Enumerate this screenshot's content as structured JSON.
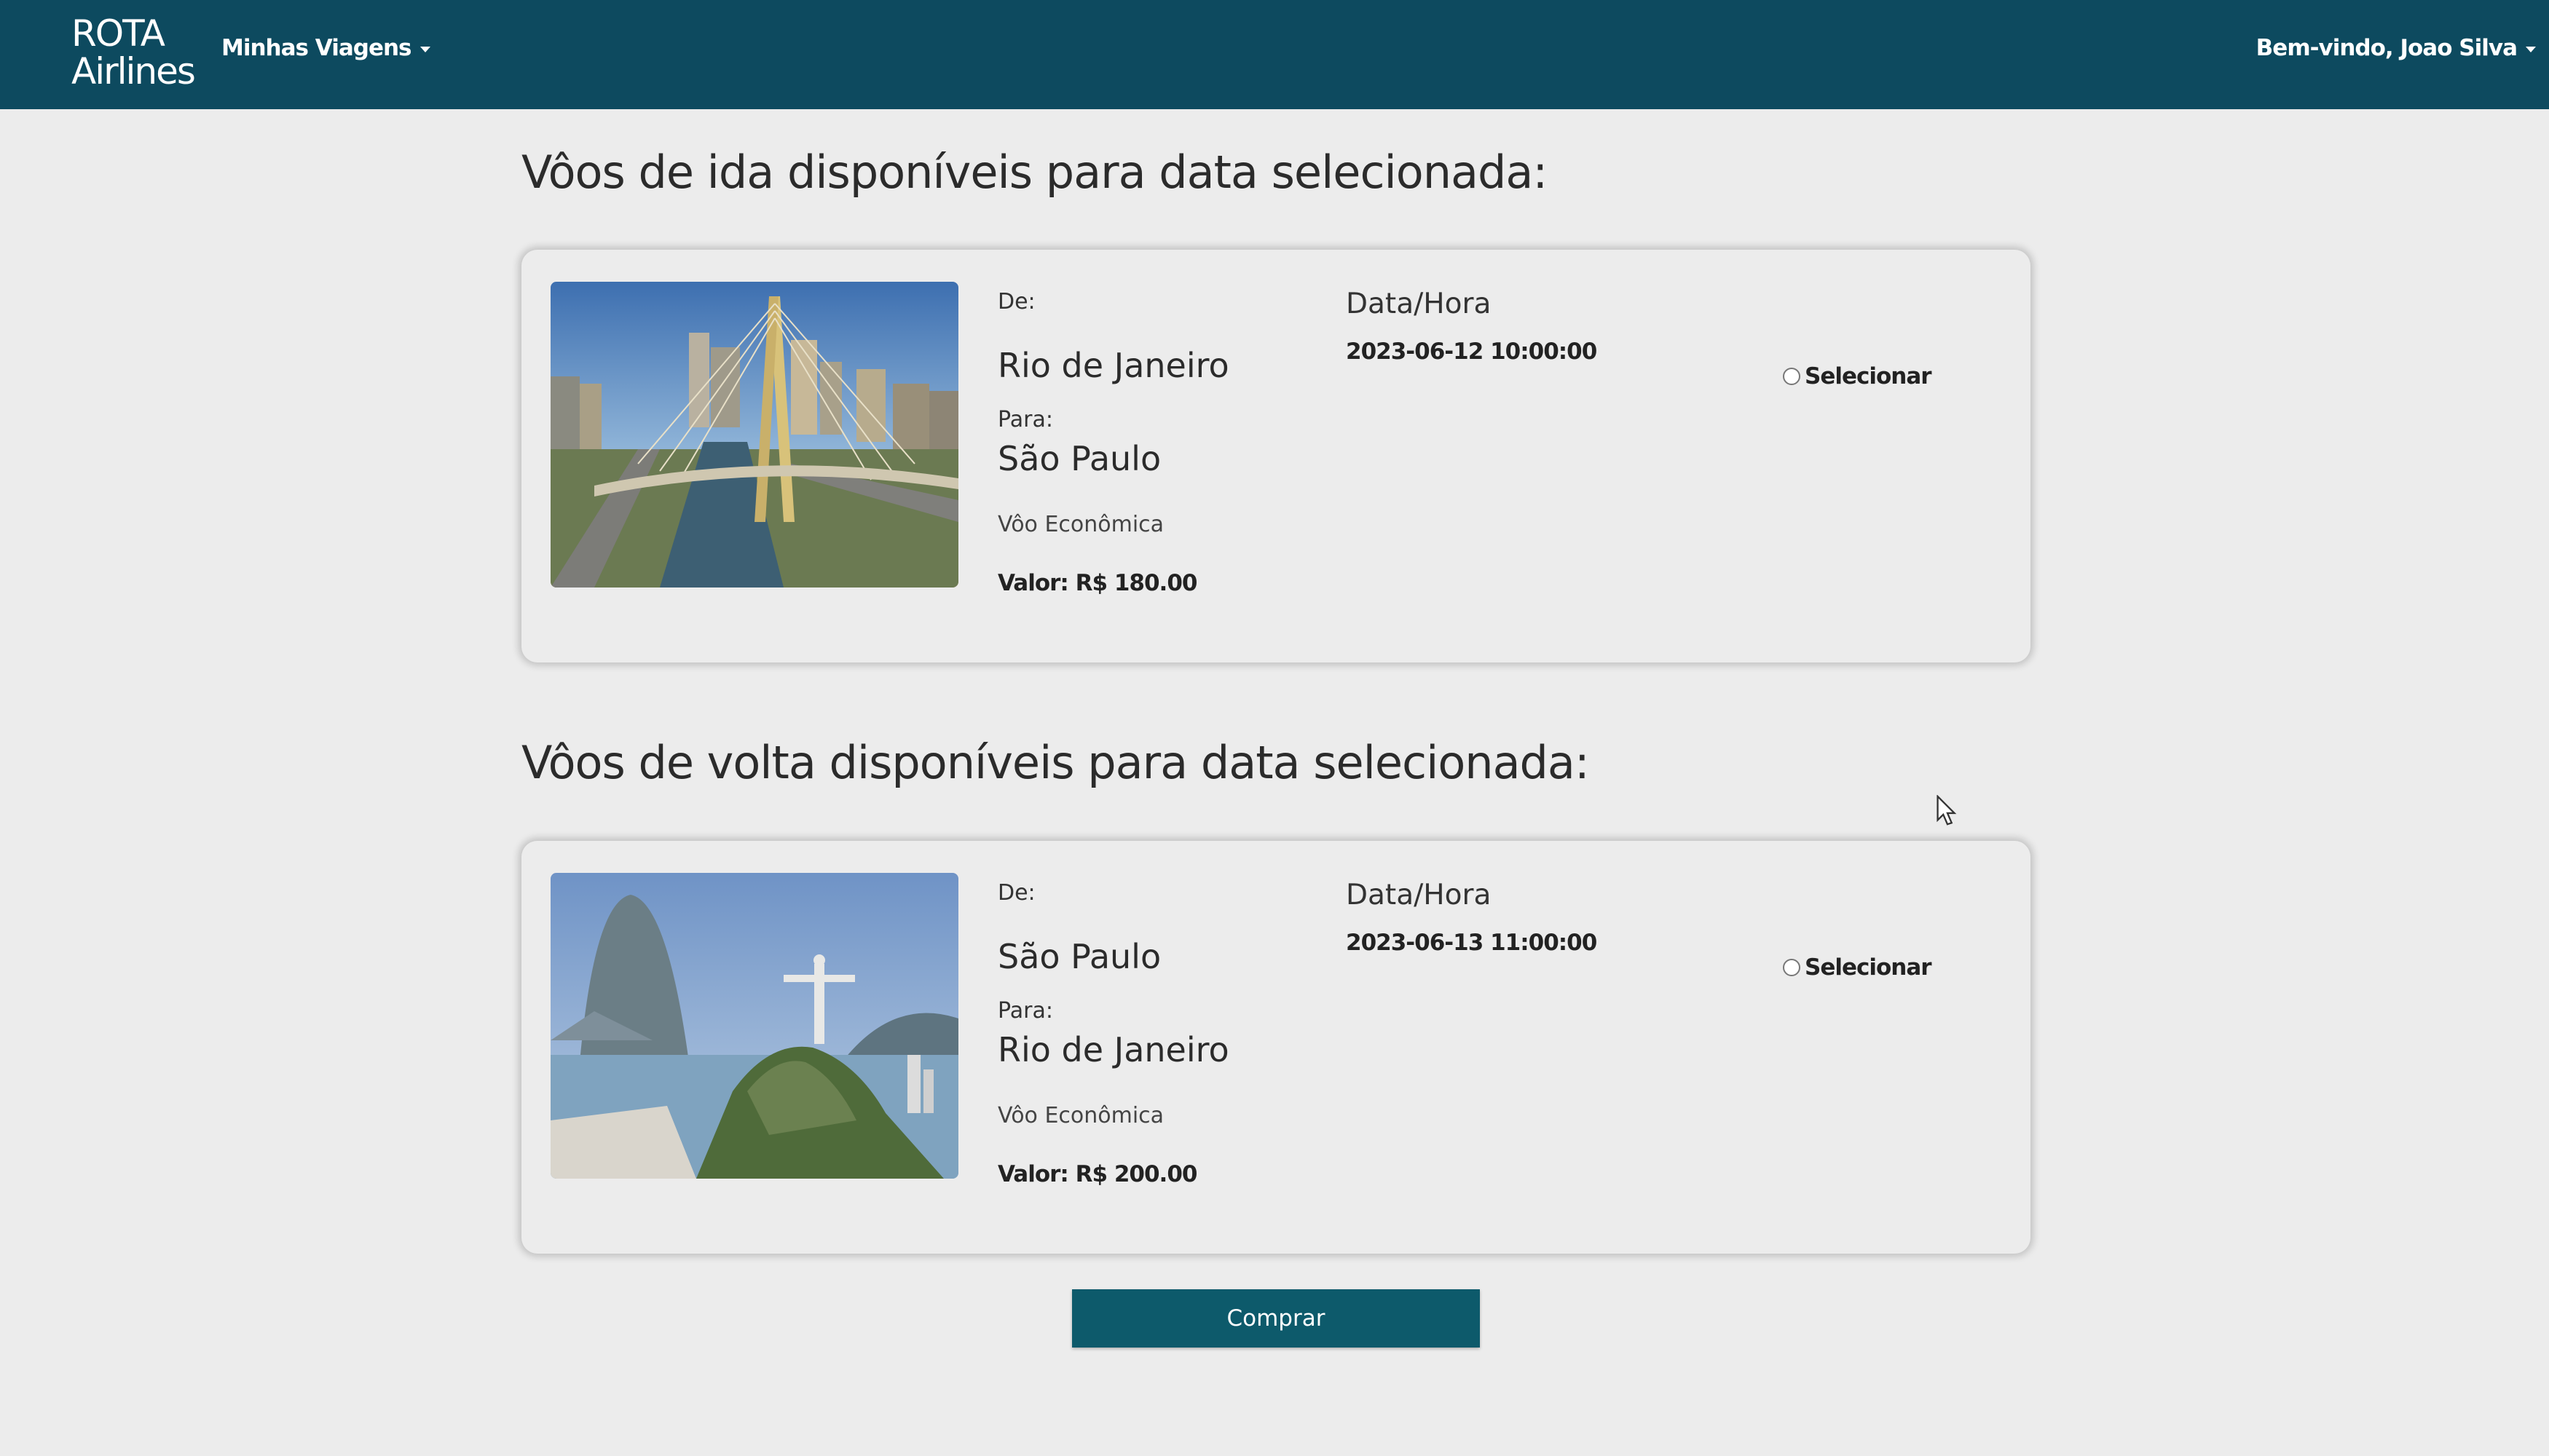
{
  "navbar": {
    "brand_line1": "ROTA",
    "brand_line2": "Airlines",
    "menu_label": "Minhas Viagens",
    "user_label": "Bem-vindo, Joao Silva"
  },
  "outbound": {
    "title": "Vôos de ida disponíveis para data selecionada:",
    "from_label": "De:",
    "from_city": "Rio de Janeiro",
    "to_label": "Para:",
    "to_city": "São Paulo",
    "class": "Vôo Econômica",
    "price": "Valor: R$ 180.00",
    "datetime_label": "Data/Hora",
    "datetime": "2023-06-12 10:00:00",
    "select_label": "Selecionar"
  },
  "return": {
    "title": "Vôos de volta disponíveis para data selecionada:",
    "from_label": "De:",
    "from_city": "São Paulo",
    "to_label": "Para:",
    "to_city": "Rio de Janeiro",
    "class": "Vôo Econômica",
    "price": "Valor: R$ 200.00",
    "datetime_label": "Data/Hora",
    "datetime": "2023-06-13 11:00:00",
    "select_label": "Selecionar"
  },
  "buy_label": "Comprar",
  "colors": {
    "navbar": "#0d4a5f",
    "button": "#0d5a6b",
    "background": "#ececec"
  }
}
